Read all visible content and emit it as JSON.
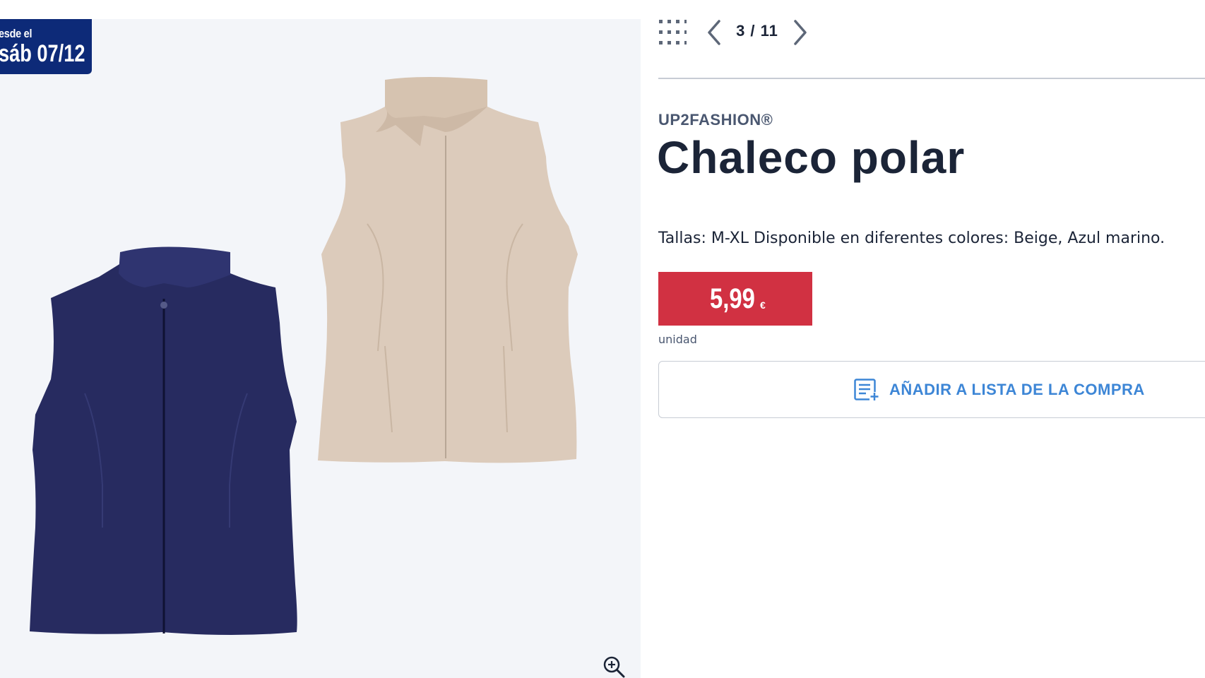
{
  "badge": {
    "line1": "esde el",
    "line2": "sáb 07/12"
  },
  "gallery": {
    "current": "3",
    "total": "11",
    "counter": "3 / 11"
  },
  "product": {
    "brand": "UP2FASHION®",
    "title": "Chaleco polar",
    "description": "Tallas: M-XL Disponible en diferentes colores: Beige, Azul marino.",
    "price": "5,99",
    "currency": "€",
    "unit": "unidad"
  },
  "actions": {
    "add_to_list": "AÑADIR A LISTA DE LA COMPRA"
  },
  "icons": {
    "grid": "grid-icon",
    "prev": "chevron-left-icon",
    "next": "chevron-right-icon",
    "zoom": "zoom-in-icon",
    "list": "shopping-list-add-icon"
  },
  "colors": {
    "badge": "#0d2a78",
    "price": "#d13142",
    "link": "#3d86d6",
    "text": "#1b2437"
  }
}
